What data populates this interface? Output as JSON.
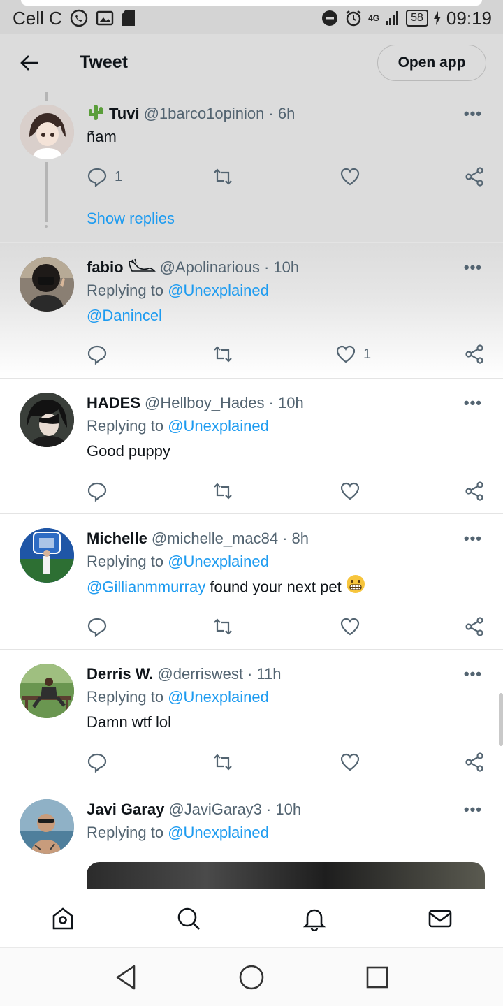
{
  "status_bar": {
    "carrier": "Cell C",
    "network": "4G",
    "battery": "58",
    "time": "09:19"
  },
  "header": {
    "title": "Tweet",
    "open_app_label": "Open app"
  },
  "tweets": [
    {
      "name": "Tuvi",
      "handle": "@1barco1opinion",
      "time": "· 6h",
      "reply_prefix": "",
      "reply_to": "",
      "text": "ñam",
      "reply_count": "1",
      "like_count": "",
      "show_replies": "Show replies"
    },
    {
      "name": "fabio",
      "handle": "@Apolinarious",
      "time": "· 10h",
      "reply_prefix": "Replying to",
      "reply_to": "@Unexplained",
      "mention": "@Danincel",
      "text": "",
      "reply_count": "",
      "like_count": "1"
    },
    {
      "name": "HADES",
      "handle": "@Hellboy_Hades",
      "time": "· 10h",
      "reply_prefix": "Replying to",
      "reply_to": "@Unexplained",
      "text": "Good puppy"
    },
    {
      "name": "Michelle",
      "handle": "@michelle_mac84",
      "time": "· 8h",
      "reply_prefix": "Replying to",
      "reply_to": "@Unexplained",
      "mention": "@Gillianmmurray",
      "text": "found your next pet",
      "emoji": "😬"
    },
    {
      "name": "Derris W.",
      "handle": "@derriswest",
      "time": "· 11h",
      "reply_prefix": "Replying to",
      "reply_to": "@Unexplained",
      "text": "Damn wtf lol"
    },
    {
      "name": "Javi Garay",
      "handle": "@JaviGaray3",
      "time": "· 10h",
      "reply_prefix": "Replying to",
      "reply_to": "@Unexplained",
      "text": ""
    }
  ],
  "more_label": "•••",
  "icons": {
    "back": "arrow-left-icon",
    "reply": "reply-icon",
    "retweet": "retweet-icon",
    "like": "heart-icon",
    "share": "share-icon",
    "home": "home-icon",
    "search": "search-icon",
    "notifications": "bell-icon",
    "messages": "mail-icon"
  },
  "colors": {
    "link": "#1d9bf0",
    "muted": "#536471",
    "header_bg": "#dcdcdc"
  }
}
